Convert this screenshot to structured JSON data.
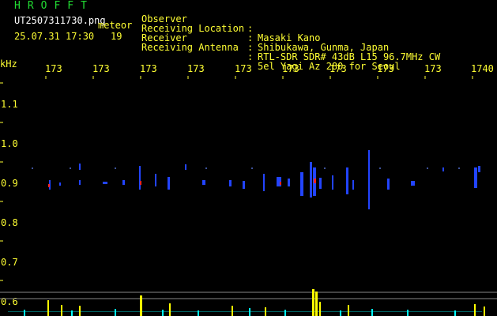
{
  "app": {
    "title": "HROFFT",
    "filename": "UT2507311730.png",
    "mode": "meteor",
    "timestamp": "25.07.31 17:30",
    "count": "19"
  },
  "header": {
    "rows": [
      {
        "label": "Observer",
        "value": "Masaki Kano"
      },
      {
        "label": "Receiving Location",
        "value": "Shibukawa, Gunma, Japan"
      },
      {
        "label": "Receiver",
        "value": "RTL-SDR SDR# 43dB L15 96.7MHz CW"
      },
      {
        "label": "Receiving Antenna",
        "value": "5el Yagi Az 280 for Seoul"
      }
    ]
  },
  "axis": {
    "unit": "kHz",
    "y_labels": [
      "1.1",
      "1.0",
      "0.9",
      "0.8",
      "0.7",
      "0.6"
    ],
    "x_labels": [
      "173",
      "173",
      "173",
      "173",
      "173",
      "173",
      "173",
      "173",
      "173",
      "1740"
    ]
  },
  "colors": {
    "text_yellow": "#ffff33",
    "text_green": "#22dd33",
    "background": "#000000",
    "echo_blue": "#2244ff",
    "echo_red": "#ff2222",
    "bar_yellow": "#ffff00",
    "bar_cyan": "#00ffff"
  }
}
